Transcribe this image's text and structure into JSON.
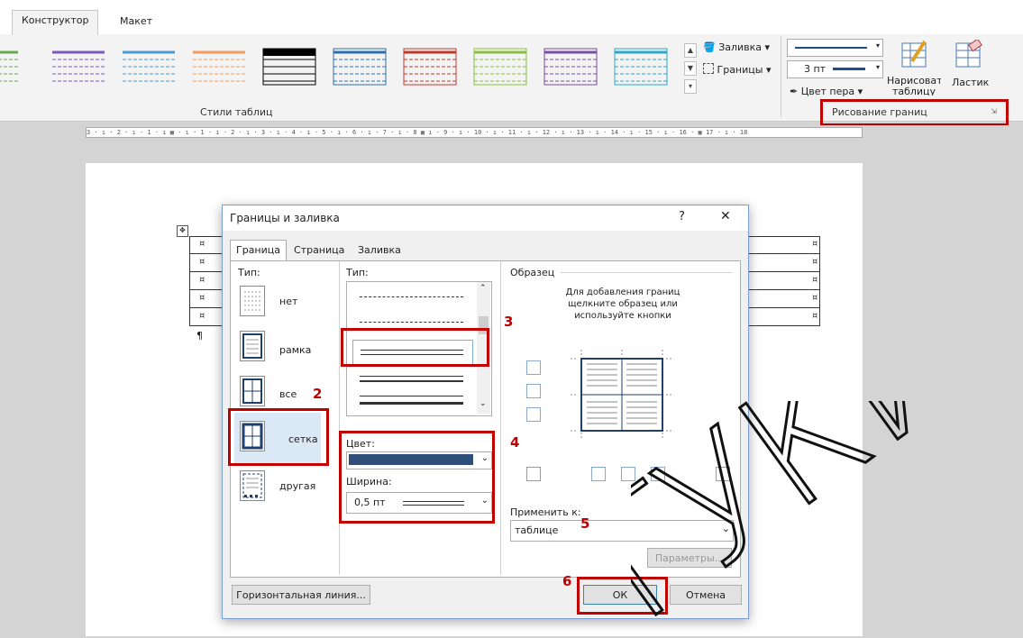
{
  "ribbon": {
    "tabs": [
      "Конструктор",
      "Макет"
    ],
    "group_styles_label": "Стили таблиц",
    "fill_label": "Заливка",
    "borders_label": "Границы",
    "pen_width": "3 пт",
    "pen_color_label": "Цвет пера",
    "draw_table_label": "Нарисовать таблицу",
    "eraser_label": "Ластик",
    "group_draw_label": "Рисование границ",
    "style_colors": [
      "#6aa84f",
      "#7e57c2",
      "#4a9bd6",
      "#f39b5a",
      "#000000",
      "#2f6fb0",
      "#c0392b",
      "#8bbf3f",
      "#7a4ea3",
      "#2ba9c9"
    ]
  },
  "ruler": {
    "text": "3 · ı · 2 · ı · 1 · ı ▦ · ı · 1 · ı · 2 · ı · 3 · ı · 4 · ı · 5 · ı · 6 · ı · 7 · ı · 8 ▦ ı · 9 · ı · 10 · ı · 11 · ı · 12 · ı · 13 · ı · 14 · ı · 15 · ı · 16 · ▦ 17 · ı · 18"
  },
  "document": {
    "cell_mark": "¤",
    "para_mark": "¶",
    "move_handle": "✥"
  },
  "dialog": {
    "title": "Границы и заливка",
    "help": "?",
    "close": "✕",
    "tabs": [
      "Граница",
      "Страница",
      "Заливка"
    ],
    "type_label": "Тип:",
    "setting_none": "нет",
    "setting_box": "рамка",
    "setting_all": "все",
    "setting_grid": "сетка",
    "setting_custom": "другая",
    "style_label": "Тип:",
    "color_label": "Цвет:",
    "width_label": "Ширина:",
    "width_value": "0,5 пт",
    "preview_label": "Образец",
    "preview_hint": "Для добавления границ щелкните образец или используйте кнопки",
    "apply_to_label": "Применить к:",
    "apply_to_value": "таблице",
    "options_button": "Параметры...",
    "hline_button": "Горизонтальная линия...",
    "ok": "ОК",
    "cancel": "Отмена",
    "color_value": "#2e4f7a"
  },
  "steps": [
    "2",
    "3",
    "4",
    "5",
    "6"
  ],
  "watermark": "ГУКИ"
}
